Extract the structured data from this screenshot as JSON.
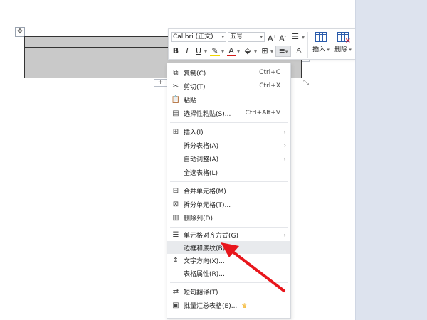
{
  "toolbar": {
    "font_name": "Calibri (正文)",
    "font_size": "五号",
    "insert_label": "插入",
    "delete_label": "删除"
  },
  "menu": {
    "items": [
      {
        "label": "复制(C)",
        "shortcut": "Ctrl+C",
        "icon": "copy-icon"
      },
      {
        "label": "剪切(T)",
        "shortcut": "Ctrl+X",
        "icon": "cut-icon"
      },
      {
        "label": "粘贴",
        "shortcut": "",
        "icon": "paste-icon"
      },
      {
        "label": "选择性粘贴(S)...",
        "shortcut": "Ctrl+Alt+V",
        "icon": "paste-special-icon"
      },
      {
        "label": "插入(I)",
        "icon": "insert-table-icon"
      },
      {
        "label": "拆分表格(A)"
      },
      {
        "label": "自动调整(A)"
      },
      {
        "label": "全选表格(L)"
      },
      {
        "label": "合并单元格(M)",
        "icon": "merge-cells-icon"
      },
      {
        "label": "拆分单元格(T)...",
        "icon": "split-cells-icon"
      },
      {
        "label": "删除列(D)",
        "icon": "delete-column-icon"
      },
      {
        "label": "单元格对齐方式(G)",
        "icon": "cell-align-icon"
      },
      {
        "label": "边框和底纹(B)..."
      },
      {
        "label": "文字方向(X)...",
        "icon": "text-direction-icon"
      },
      {
        "label": "表格属性(R)..."
      },
      {
        "label": "短句翻译(T)",
        "icon": "translate-icon"
      },
      {
        "label": "批量汇总表格(E)...",
        "icon": "batch-summary-icon"
      }
    ]
  },
  "colors": {
    "arrow": "#e8161c",
    "table_fill": "#c9c9c9",
    "side_panel": "#dde3ee",
    "highlight": "#e8eaed"
  }
}
